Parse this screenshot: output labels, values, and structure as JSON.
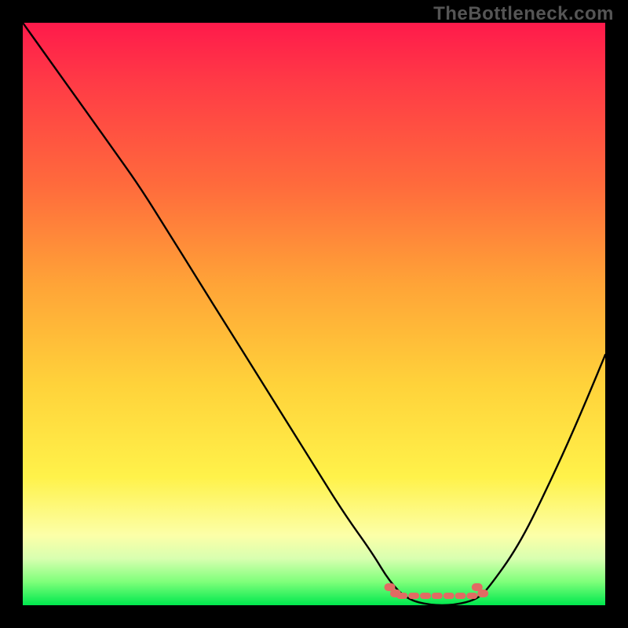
{
  "watermark": "TheBottleneck.com",
  "chart_data": {
    "type": "line",
    "title": "",
    "xlabel": "",
    "ylabel": "",
    "xlim": [
      0,
      100
    ],
    "ylim": [
      0,
      100
    ],
    "grid": false,
    "legend": false,
    "series": [
      {
        "name": "bottleneck-curve",
        "x": [
          0,
          5,
          10,
          15,
          20,
          25,
          30,
          35,
          40,
          45,
          50,
          55,
          60,
          63,
          66,
          70,
          74,
          78,
          80,
          85,
          90,
          95,
          100
        ],
        "y": [
          100,
          93,
          86,
          79,
          72,
          64,
          56,
          48,
          40,
          32,
          24,
          16,
          9,
          4,
          1,
          0,
          0,
          1,
          3,
          10,
          20,
          31,
          43
        ]
      }
    ],
    "optimal_band": {
      "x_start": 63,
      "x_end": 79,
      "marker_color": "#e26b63"
    },
    "background_gradient": {
      "direction": "vertical",
      "stops": [
        {
          "pos": 0,
          "color": "#ff1a4b"
        },
        {
          "pos": 10,
          "color": "#ff3a46"
        },
        {
          "pos": 28,
          "color": "#ff6b3c"
        },
        {
          "pos": 45,
          "color": "#ffa437"
        },
        {
          "pos": 62,
          "color": "#ffd23a"
        },
        {
          "pos": 78,
          "color": "#fff24a"
        },
        {
          "pos": 88,
          "color": "#fcffa8"
        },
        {
          "pos": 92,
          "color": "#d8ffb0"
        },
        {
          "pos": 96,
          "color": "#7eff7a"
        },
        {
          "pos": 100,
          "color": "#00e84e"
        }
      ]
    }
  }
}
